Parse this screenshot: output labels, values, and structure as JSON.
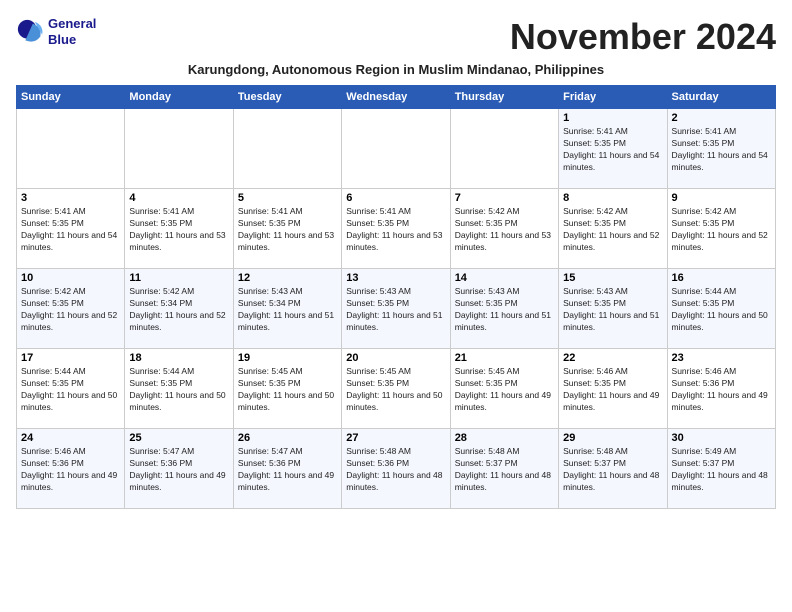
{
  "header": {
    "logo_line1": "General",
    "logo_line2": "Blue",
    "month_title": "November 2024",
    "subtitle": "Karungdong, Autonomous Region in Muslim Mindanao, Philippines"
  },
  "weekdays": [
    "Sunday",
    "Monday",
    "Tuesday",
    "Wednesday",
    "Thursday",
    "Friday",
    "Saturday"
  ],
  "weeks": [
    [
      {
        "day": "",
        "sunrise": "",
        "sunset": "",
        "daylight": ""
      },
      {
        "day": "",
        "sunrise": "",
        "sunset": "",
        "daylight": ""
      },
      {
        "day": "",
        "sunrise": "",
        "sunset": "",
        "daylight": ""
      },
      {
        "day": "",
        "sunrise": "",
        "sunset": "",
        "daylight": ""
      },
      {
        "day": "",
        "sunrise": "",
        "sunset": "",
        "daylight": ""
      },
      {
        "day": "1",
        "sunrise": "Sunrise: 5:41 AM",
        "sunset": "Sunset: 5:35 PM",
        "daylight": "Daylight: 11 hours and 54 minutes."
      },
      {
        "day": "2",
        "sunrise": "Sunrise: 5:41 AM",
        "sunset": "Sunset: 5:35 PM",
        "daylight": "Daylight: 11 hours and 54 minutes."
      }
    ],
    [
      {
        "day": "3",
        "sunrise": "Sunrise: 5:41 AM",
        "sunset": "Sunset: 5:35 PM",
        "daylight": "Daylight: 11 hours and 54 minutes."
      },
      {
        "day": "4",
        "sunrise": "Sunrise: 5:41 AM",
        "sunset": "Sunset: 5:35 PM",
        "daylight": "Daylight: 11 hours and 53 minutes."
      },
      {
        "day": "5",
        "sunrise": "Sunrise: 5:41 AM",
        "sunset": "Sunset: 5:35 PM",
        "daylight": "Daylight: 11 hours and 53 minutes."
      },
      {
        "day": "6",
        "sunrise": "Sunrise: 5:41 AM",
        "sunset": "Sunset: 5:35 PM",
        "daylight": "Daylight: 11 hours and 53 minutes."
      },
      {
        "day": "7",
        "sunrise": "Sunrise: 5:42 AM",
        "sunset": "Sunset: 5:35 PM",
        "daylight": "Daylight: 11 hours and 53 minutes."
      },
      {
        "day": "8",
        "sunrise": "Sunrise: 5:42 AM",
        "sunset": "Sunset: 5:35 PM",
        "daylight": "Daylight: 11 hours and 52 minutes."
      },
      {
        "day": "9",
        "sunrise": "Sunrise: 5:42 AM",
        "sunset": "Sunset: 5:35 PM",
        "daylight": "Daylight: 11 hours and 52 minutes."
      }
    ],
    [
      {
        "day": "10",
        "sunrise": "Sunrise: 5:42 AM",
        "sunset": "Sunset: 5:35 PM",
        "daylight": "Daylight: 11 hours and 52 minutes."
      },
      {
        "day": "11",
        "sunrise": "Sunrise: 5:42 AM",
        "sunset": "Sunset: 5:34 PM",
        "daylight": "Daylight: 11 hours and 52 minutes."
      },
      {
        "day": "12",
        "sunrise": "Sunrise: 5:43 AM",
        "sunset": "Sunset: 5:34 PM",
        "daylight": "Daylight: 11 hours and 51 minutes."
      },
      {
        "day": "13",
        "sunrise": "Sunrise: 5:43 AM",
        "sunset": "Sunset: 5:35 PM",
        "daylight": "Daylight: 11 hours and 51 minutes."
      },
      {
        "day": "14",
        "sunrise": "Sunrise: 5:43 AM",
        "sunset": "Sunset: 5:35 PM",
        "daylight": "Daylight: 11 hours and 51 minutes."
      },
      {
        "day": "15",
        "sunrise": "Sunrise: 5:43 AM",
        "sunset": "Sunset: 5:35 PM",
        "daylight": "Daylight: 11 hours and 51 minutes."
      },
      {
        "day": "16",
        "sunrise": "Sunrise: 5:44 AM",
        "sunset": "Sunset: 5:35 PM",
        "daylight": "Daylight: 11 hours and 50 minutes."
      }
    ],
    [
      {
        "day": "17",
        "sunrise": "Sunrise: 5:44 AM",
        "sunset": "Sunset: 5:35 PM",
        "daylight": "Daylight: 11 hours and 50 minutes."
      },
      {
        "day": "18",
        "sunrise": "Sunrise: 5:44 AM",
        "sunset": "Sunset: 5:35 PM",
        "daylight": "Daylight: 11 hours and 50 minutes."
      },
      {
        "day": "19",
        "sunrise": "Sunrise: 5:45 AM",
        "sunset": "Sunset: 5:35 PM",
        "daylight": "Daylight: 11 hours and 50 minutes."
      },
      {
        "day": "20",
        "sunrise": "Sunrise: 5:45 AM",
        "sunset": "Sunset: 5:35 PM",
        "daylight": "Daylight: 11 hours and 50 minutes."
      },
      {
        "day": "21",
        "sunrise": "Sunrise: 5:45 AM",
        "sunset": "Sunset: 5:35 PM",
        "daylight": "Daylight: 11 hours and 49 minutes."
      },
      {
        "day": "22",
        "sunrise": "Sunrise: 5:46 AM",
        "sunset": "Sunset: 5:35 PM",
        "daylight": "Daylight: 11 hours and 49 minutes."
      },
      {
        "day": "23",
        "sunrise": "Sunrise: 5:46 AM",
        "sunset": "Sunset: 5:36 PM",
        "daylight": "Daylight: 11 hours and 49 minutes."
      }
    ],
    [
      {
        "day": "24",
        "sunrise": "Sunrise: 5:46 AM",
        "sunset": "Sunset: 5:36 PM",
        "daylight": "Daylight: 11 hours and 49 minutes."
      },
      {
        "day": "25",
        "sunrise": "Sunrise: 5:47 AM",
        "sunset": "Sunset: 5:36 PM",
        "daylight": "Daylight: 11 hours and 49 minutes."
      },
      {
        "day": "26",
        "sunrise": "Sunrise: 5:47 AM",
        "sunset": "Sunset: 5:36 PM",
        "daylight": "Daylight: 11 hours and 49 minutes."
      },
      {
        "day": "27",
        "sunrise": "Sunrise: 5:48 AM",
        "sunset": "Sunset: 5:36 PM",
        "daylight": "Daylight: 11 hours and 48 minutes."
      },
      {
        "day": "28",
        "sunrise": "Sunrise: 5:48 AM",
        "sunset": "Sunset: 5:37 PM",
        "daylight": "Daylight: 11 hours and 48 minutes."
      },
      {
        "day": "29",
        "sunrise": "Sunrise: 5:48 AM",
        "sunset": "Sunset: 5:37 PM",
        "daylight": "Daylight: 11 hours and 48 minutes."
      },
      {
        "day": "30",
        "sunrise": "Sunrise: 5:49 AM",
        "sunset": "Sunset: 5:37 PM",
        "daylight": "Daylight: 11 hours and 48 minutes."
      }
    ]
  ]
}
